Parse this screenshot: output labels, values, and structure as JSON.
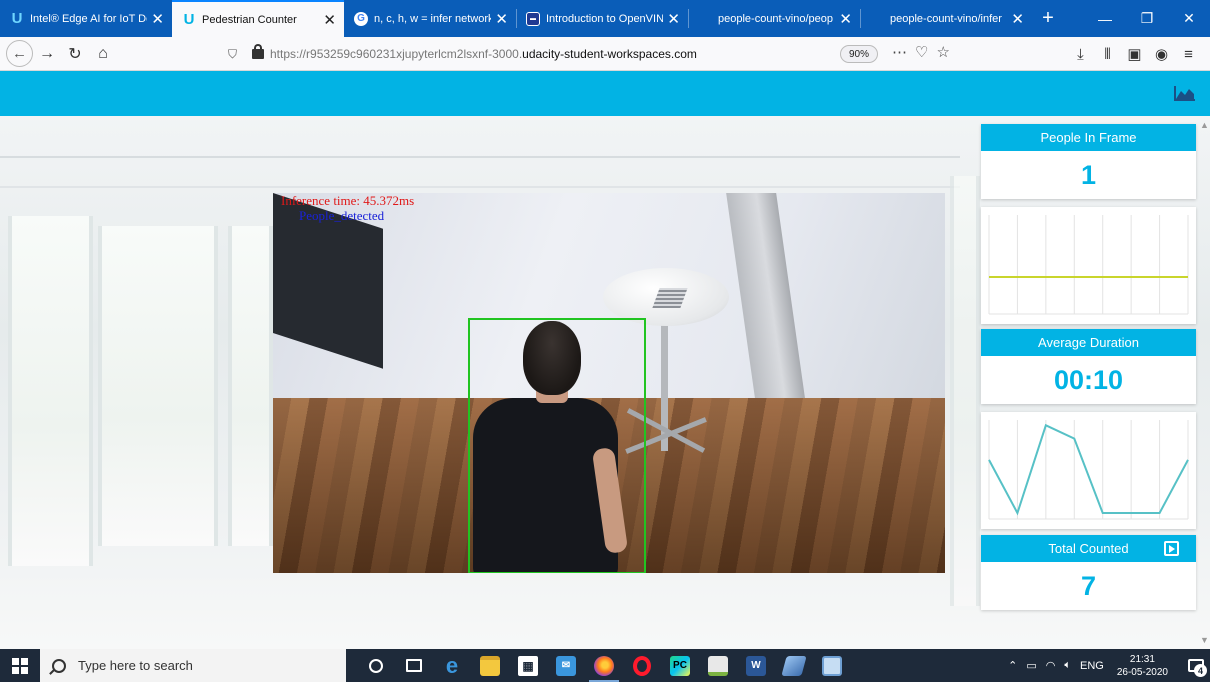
{
  "browser": {
    "tabs": [
      {
        "title": "Intel® Edge AI for IoT De",
        "icon": "udacity-icon"
      },
      {
        "title": "Pedestrian Counter",
        "icon": "udacity-icon",
        "active": true
      },
      {
        "title": "n, c, h, w = infer network",
        "icon": "google-icon"
      },
      {
        "title": "Introduction to OpenVINO",
        "icon": "openvino-icon"
      },
      {
        "title": "people-count-vino/peop",
        "icon": "blank-icon"
      },
      {
        "title": "people-count-vino/infer",
        "icon": "blank-icon"
      }
    ],
    "url_prefix": "https://r953259c960231xjupyterlcm2lsxnf-3000.",
    "url_host": "udacity-student-workspaces.com",
    "zoom": "90%"
  },
  "video": {
    "inference_text": "Inference time: 45.372ms",
    "detected_text": "People_detected"
  },
  "stats": {
    "people_in_frame_label": "People In Frame",
    "people_in_frame_value": "1",
    "average_duration_label": "Average Duration",
    "average_duration_value": "00:10",
    "total_counted_label": "Total Counted",
    "total_counted_value": "7"
  },
  "chart_data": [
    {
      "type": "line",
      "title": "",
      "x": [
        0,
        1,
        2,
        3,
        4,
        5,
        6,
        7
      ],
      "series": [
        {
          "values": [
            1,
            1,
            1,
            1,
            1,
            1,
            1,
            1
          ]
        }
      ],
      "ylim": [
        0,
        3
      ],
      "grid": true,
      "color": "#c9d52c"
    },
    {
      "type": "line",
      "title": "",
      "x": [
        0,
        1,
        2,
        3,
        4,
        5,
        6,
        7
      ],
      "series": [
        {
          "values": [
            2,
            0,
            3.3,
            2.8,
            0,
            0,
            0,
            2
          ]
        }
      ],
      "ylim": [
        0,
        3.5
      ],
      "grid": true,
      "color": "#57c1c6"
    }
  ],
  "taskbar": {
    "search_placeholder": "Type here to search",
    "language": "ENG",
    "time": "21:31",
    "date": "26-05-2020",
    "notification_count": "4"
  },
  "colors": {
    "accent": "#02b3e4",
    "bbox": "#21c421"
  }
}
